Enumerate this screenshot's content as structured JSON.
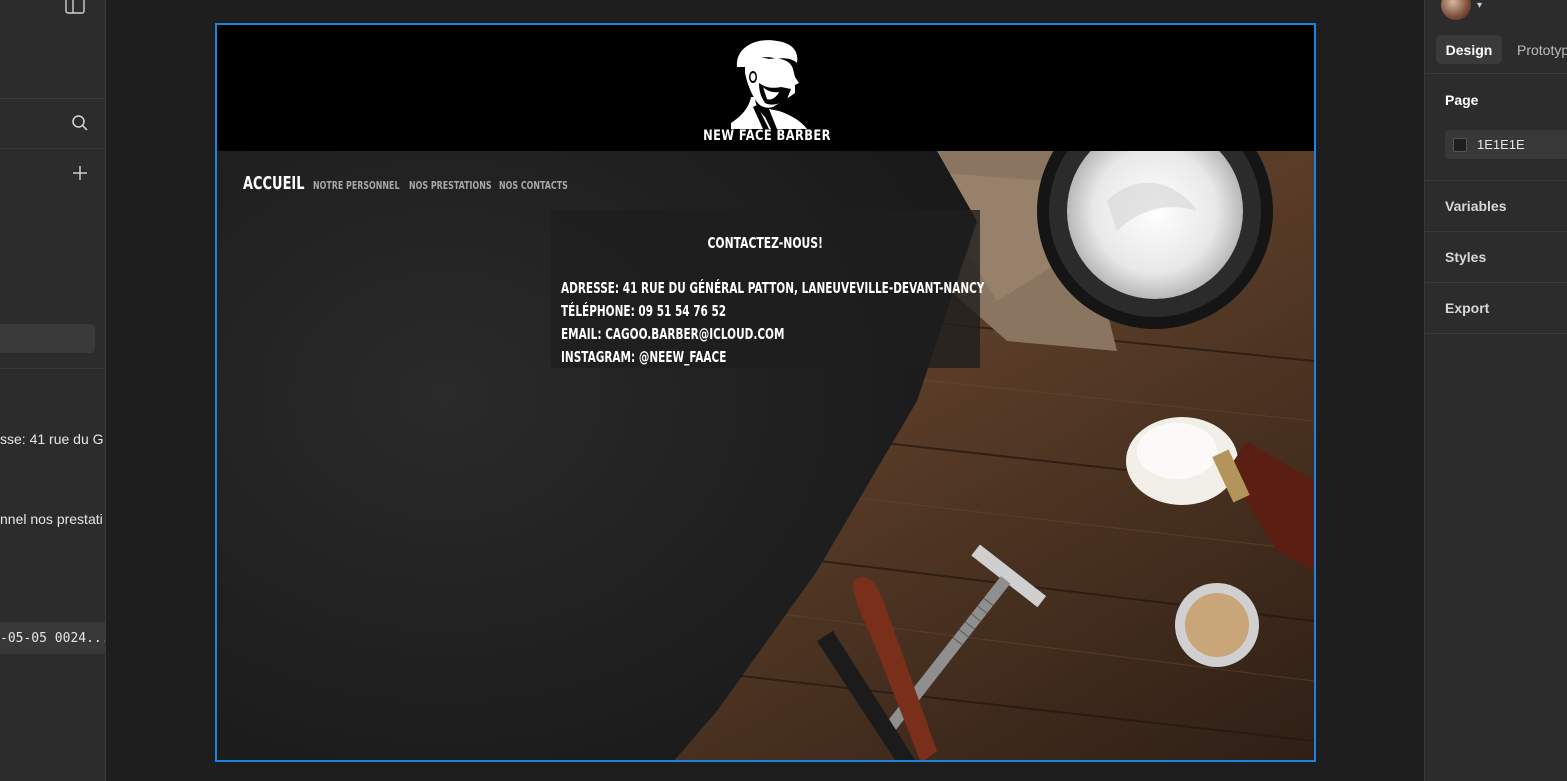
{
  "left_panel": {
    "layers": [
      {
        "text": "sse: 41 rue du G"
      },
      {
        "text": "nnel nos prestati"
      }
    ],
    "timestamp_layer": "-05-05 0024..."
  },
  "site": {
    "brand": "NEW FACE BARBER",
    "nav": {
      "main": "ACCUEIL",
      "items": [
        "NOTRE PERSONNEL",
        "NOS PRESTATIONS",
        "NOS CONTACTS"
      ]
    },
    "contact": {
      "title": "CONTACTEZ-NOUS!",
      "lines": [
        "ADRESSE: 41 RUE DU GÉNÉRAL PATTON, LANEUVEVILLE-DEVANT-NANCY",
        "TÉLÉPHONE: 09 51 54 76 52",
        "EMAIL: CAGOO.BARBER@ICLOUD.COM",
        "INSTAGRAM: @NEEW_FAACE"
      ]
    }
  },
  "right_panel": {
    "tabs": {
      "design": "Design",
      "prototype": "Prototyp"
    },
    "page": {
      "heading": "Page",
      "color_hex": "1E1E1E",
      "swatch_color": "#1e1e1e"
    },
    "sections": [
      "Variables",
      "Styles",
      "Export"
    ]
  },
  "colors": {
    "selection_blue": "#1a84e0",
    "canvas_bg": "#1e1e1e",
    "panel_bg": "#2c2c2c"
  }
}
